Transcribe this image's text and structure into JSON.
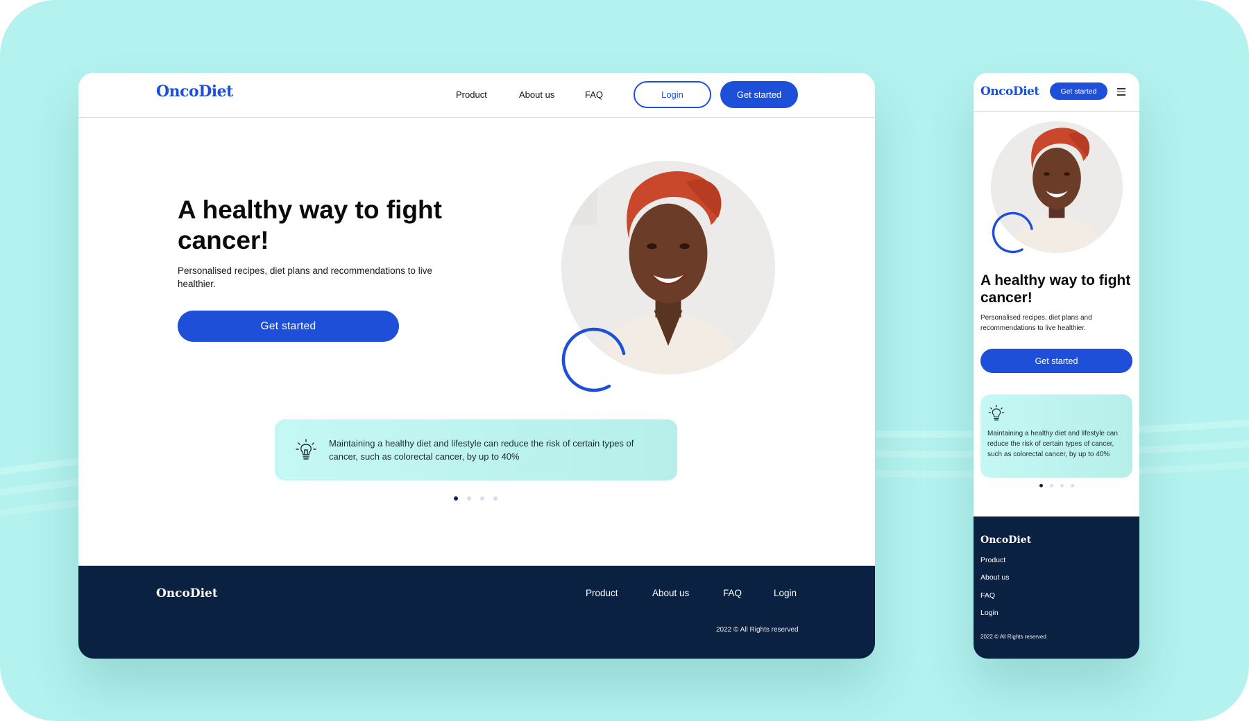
{
  "brand": {
    "name": "OncoDiet",
    "primary_color": "#1e4fd9",
    "footer_color": "#0b2142",
    "background_color": "#b3f2ee",
    "card_color": "#bff5f2"
  },
  "desktop": {
    "nav": {
      "items": [
        "Product",
        "About us",
        "FAQ"
      ],
      "login_label": "Login",
      "cta_label": "Get started"
    },
    "hero": {
      "title": "A healthy way to fight cancer!",
      "subtitle": "Personalised recipes, diet plans and recommendations to live healthier.",
      "cta_label": "Get started"
    },
    "fact": {
      "icon": "lightbulb-icon",
      "text": "Maintaining a healthy diet and lifestyle can reduce the risk of certain types of cancer, such as colorectal cancer, by up to 40%"
    },
    "carousel": {
      "count": 4,
      "active": 1
    },
    "footer": {
      "links": [
        "Product",
        "About us",
        "FAQ",
        "Login"
      ],
      "copyright": "2022 © All Rights reserved"
    }
  },
  "mobile": {
    "nav": {
      "cta_label": "Get started",
      "menu_icon": "hamburger-menu-icon"
    },
    "hero": {
      "title": "A healthy way to fight cancer!",
      "subtitle": "Personalised recipes, diet plans and recommendations to live healthier.",
      "cta_label": "Get started"
    },
    "fact": {
      "icon": "lightbulb-icon",
      "text": "Maintaining a healthy diet and lifestyle can reduce the risk of certain types of cancer, such as colorectal cancer, by up to 40%"
    },
    "carousel": {
      "count": 4,
      "active": 1
    },
    "footer": {
      "links": [
        "Product",
        "About us",
        "FAQ",
        "Login"
      ],
      "copyright": "2022 © All Rights reserved"
    }
  }
}
